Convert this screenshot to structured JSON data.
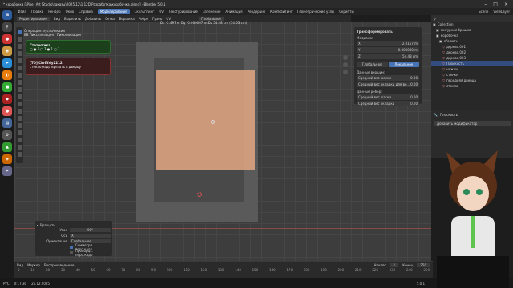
{
  "title_bar": {
    "title": "* корабочка [\\Pixel_Art_Studio\\заказы\\2025\\12\\1 12D\\Разработка\\корабочка.blend] - Blender 5.0.1"
  },
  "menu": {
    "items": [
      "Файл",
      "Правка",
      "Рендер",
      "Окно",
      "Справка",
      "Моделирование",
      "Скульптинг",
      "UV",
      "Текстурирование",
      "Затенение",
      "Анимация",
      "Рендеринг",
      "Композитинг",
      "Геометрические узлы",
      "Скрипты"
    ],
    "active_index": 5,
    "scene": "Scene",
    "view_layer": "ViewLayer"
  },
  "header2": {
    "mode": "Редактирование",
    "items": [
      "Вид",
      "Выделить",
      "Добавить",
      "Сетка",
      "Вершина",
      "Ребро",
      "Грань",
      "UV"
    ],
    "orientation": "Глобальное"
  },
  "status_line": "Dx -2.497 m  Dy -0.000007 m  Dz 54.48 cm (54.63 cm)",
  "op_info": {
    "line1": "Операция: пусто/сессия",
    "line2": "ВВ Пикселизация | Пикселизация"
  },
  "toast1": {
    "title": "Статистика",
    "line": "▢ ● 6 ◸ 7 ● 1 ◻ 1"
  },
  "toast2": {
    "user": "[ТО] Chriffrly2212",
    "message": "стекло надо врезать в дверцу"
  },
  "npanel": {
    "title": "Трансформировать",
    "median": "Медиана:",
    "x": {
      "label": "X",
      "value": "2.0167 m"
    },
    "y": {
      "label": "Y",
      "value": "-0.000000 m"
    },
    "z": {
      "label": "Z",
      "value": "54.48 cm"
    },
    "mode_a": "Глобальное",
    "mode_b": "Локальное",
    "vert_data": "Данные вершин:",
    "vw": {
      "label": "Средний вес фаски",
      "value": "0.00"
    },
    "vc": {
      "label": "Средний вес складки для ве...",
      "value": "0.00"
    },
    "edge_data": "Данные рёбер:",
    "ew": {
      "label": "Средний вес фаски",
      "value": "0.00"
    },
    "ec": {
      "label": "Средний вес складки",
      "value": "0.00"
    }
  },
  "outliner": {
    "rows": [
      "Collection",
      "фигурная брошка",
      "коробочка",
      "объекты",
      "дерево.001",
      "дерево.002",
      "дерево.003",
      "Плоскость",
      "ножки",
      "стенки",
      "передняя дверца",
      "стекло"
    ],
    "selected_index": 7
  },
  "props": {
    "object": "Плоскость",
    "add_modifier": "Добавить модификатор"
  },
  "op_panel": {
    "title": "Вращать",
    "angle_label": "Угол",
    "angle_value": "90°",
    "axis_label": "Ось",
    "axis_value": "X",
    "orient_label": "Ориентация",
    "orient_value": "Глобальное",
    "cb1": "Симметри... перо.кадр",
    "cb2": "Пропорц... перо.кадр"
  },
  "timeline": {
    "items": [
      "Вид",
      "Маркер",
      "Воспроизведение"
    ],
    "start_label": "Начало",
    "start": "1",
    "end_label": "Конец",
    "end": "250",
    "ticks": [
      "0",
      "10",
      "20",
      "30",
      "40",
      "50",
      "60",
      "70",
      "80",
      "90",
      "100",
      "110",
      "120",
      "130",
      "140",
      "150",
      "160",
      "170",
      "180",
      "190",
      "200",
      "210",
      "220",
      "230",
      "240",
      "250"
    ]
  },
  "sysbar": {
    "lang": "РУС",
    "time": "0:17:30",
    "date": "25.12.2025",
    "version": "5.0.1"
  },
  "colors": {
    "accent": "#4772b3",
    "face": "#e3a783",
    "bg": "#3d3d3d"
  },
  "icons": [
    "blender-logo-icon",
    "search-icon",
    "gear-icon",
    "chrome-icon",
    "telegram-icon",
    "folder-icon"
  ]
}
